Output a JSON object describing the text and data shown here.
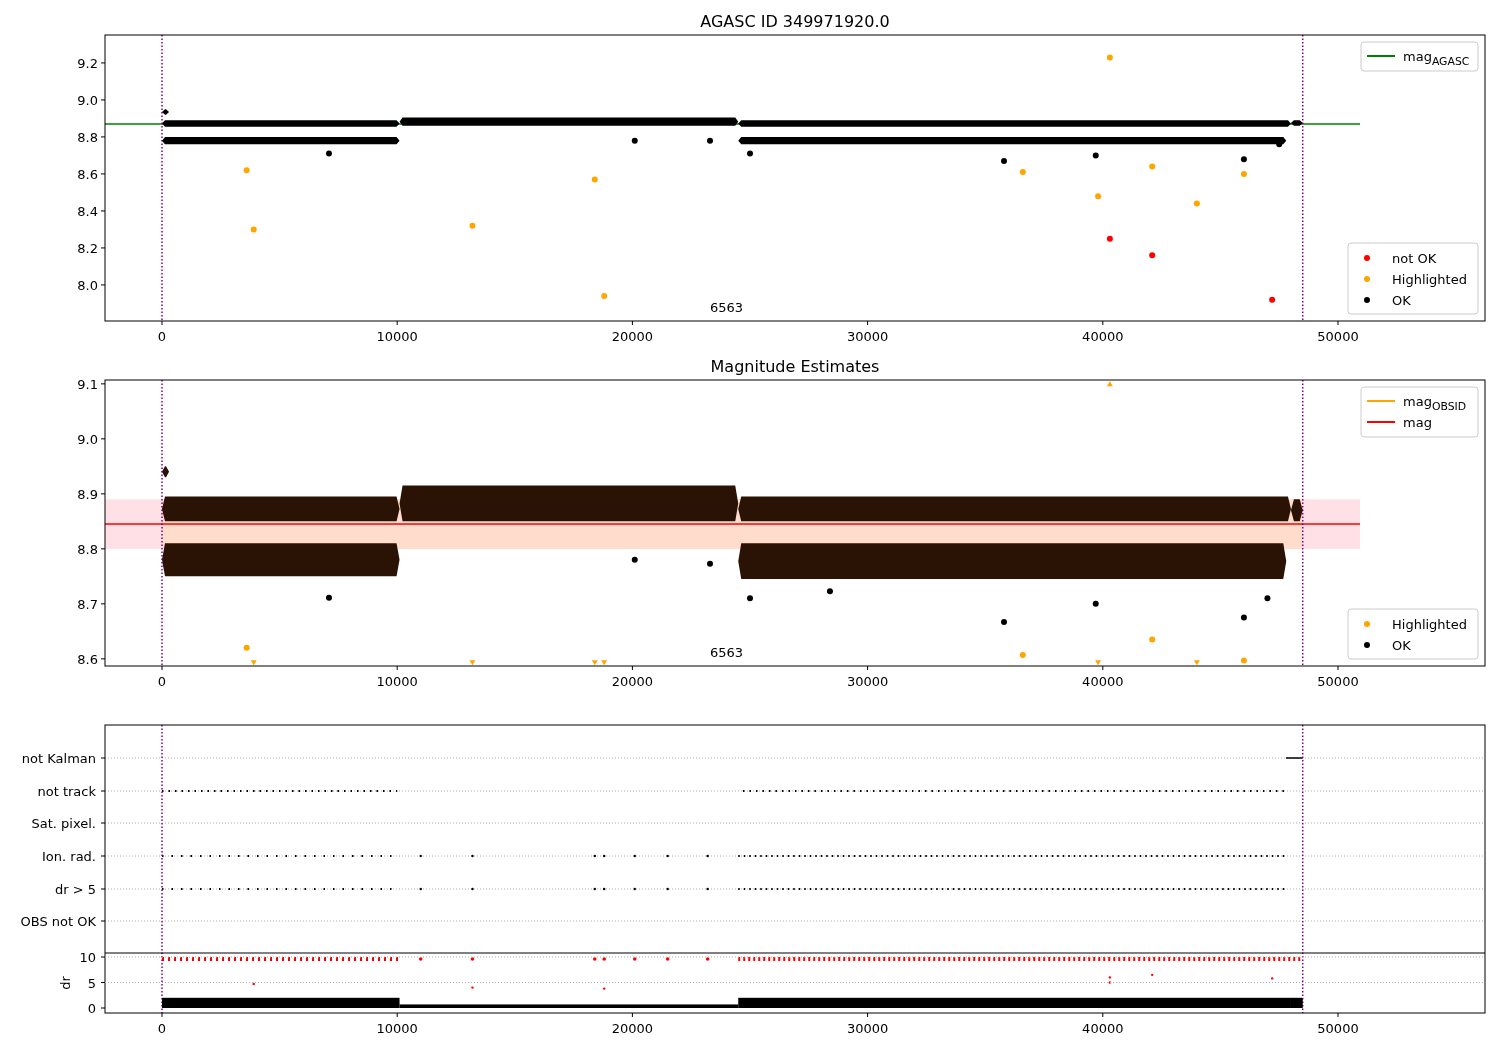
{
  "panels": [
    {
      "chart_data": {
        "type": "scatter",
        "title": "AGASC ID 349971920.0",
        "legend": "right",
        "xlim": [
          -2423,
          56250
        ],
        "ylim": [
          7.805,
          9.351
        ],
        "xticks": [
          0,
          10000,
          20000,
          30000,
          40000,
          50000
        ],
        "yticks": [
          {
            "value": 8.0,
            "label": "8.0"
          },
          {
            "value": 8.2,
            "label": "8.2"
          },
          {
            "value": 8.4,
            "label": "8.4"
          },
          {
            "value": 8.6,
            "label": "8.6"
          },
          {
            "value": 8.8,
            "label": "8.8"
          },
          {
            "value": 9.0,
            "label": "9.0"
          },
          {
            "value": 9.2,
            "label": "9.2"
          }
        ],
        "x": [
          3600,
          3900,
          7100,
          13200,
          18400,
          18800,
          20100,
          23300,
          25000,
          35800,
          36600,
          39700,
          39800,
          40300,
          42100,
          44000,
          46000,
          47200,
          47500
        ],
        "series": [
          {
            "name": "not OK",
            "color": "#ff0000",
            "values": [
              null,
              null,
              null,
              null,
              null,
              null,
              null,
              null,
              null,
              null,
              null,
              null,
              null,
              8.25,
              8.16,
              null,
              null,
              7.92,
              null
            ]
          },
          {
            "name": "Highlighted",
            "color": "#ffa500",
            "values": [
              8.62,
              8.3,
              null,
              8.32,
              8.57,
              7.94,
              null,
              null,
              null,
              null,
              8.61,
              null,
              8.48,
              9.23,
              8.64,
              8.44,
              8.6,
              null,
              null
            ]
          },
          {
            "name": "OK",
            "color": "#000000",
            "values": [
              null,
              null,
              8.71,
              null,
              null,
              null,
              8.78,
              8.78,
              8.71,
              8.67,
              null,
              8.7,
              null,
              null,
              null,
              null,
              8.68,
              null,
              8.76
            ]
          }
        ],
        "ref_lines": [
          {
            "axis": "y",
            "value": 8.87,
            "label": "mag$_{AGASC}$",
            "color": "#008000"
          },
          {
            "axis": "x",
            "value": 0,
            "color": "#800080"
          },
          {
            "axis": "x",
            "value": 48500,
            "color": "#800080"
          }
        ],
        "annotations": [
          {
            "text": "6563"
          }
        ]
      }
    },
    {
      "chart_data": {
        "type": "scatter",
        "title": "Magnitude Estimates",
        "legend": "right",
        "xlim": [
          -2423,
          56250
        ],
        "ylim": [
          8.587,
          9.107
        ],
        "xticks": [
          0,
          10000,
          20000,
          30000,
          40000,
          50000
        ],
        "yticks": [
          {
            "value": 8.6,
            "label": "8.6"
          },
          {
            "value": 8.7,
            "label": "8.7"
          },
          {
            "value": 8.8,
            "label": "8.8"
          },
          {
            "value": 8.9,
            "label": "8.9"
          },
          {
            "value": 9.0,
            "label": "9.0"
          },
          {
            "value": 9.1,
            "label": "9.1"
          }
        ],
        "x": [
          3600,
          3900,
          7100,
          13200,
          18400,
          18800,
          20100,
          23300,
          25000,
          28400,
          35800,
          36600,
          39700,
          39800,
          40300,
          42100,
          44000,
          46000,
          47000
        ],
        "series": [
          {
            "name": "Highlighted",
            "color": "#ffa500",
            "values": [
              8.62,
              8.593,
              null,
              8.593,
              8.593,
              8.593,
              null,
              null,
              null,
              null,
              null,
              8.607,
              null,
              8.593,
              9.1,
              8.635,
              8.593,
              8.597,
              null
            ]
          },
          {
            "name": "OK",
            "color": "#000000",
            "values": [
              null,
              null,
              8.711,
              null,
              null,
              null,
              8.78,
              8.773,
              8.71,
              8.723,
              8.667,
              null,
              8.7,
              null,
              null,
              null,
              null,
              8.675,
              8.71
            ]
          }
        ],
        "bands": [
          {
            "axis": "y",
            "from": 8.8,
            "to": 8.89,
            "color": "#ffe0e6"
          },
          {
            "axis": "y",
            "from": 8.8,
            "to": 8.89,
            "color": "#ffdccc"
          }
        ],
        "ref_lines": [
          {
            "axis": "y",
            "label": "mag$_{OBSID}$",
            "color": "#ffa500"
          },
          {
            "axis": "y",
            "value": 8.845,
            "label": "mag",
            "color": "#ff0000"
          },
          {
            "axis": "x",
            "value": 0,
            "color": "#800080"
          },
          {
            "axis": "x",
            "value": 48500,
            "color": "#800080"
          }
        ],
        "annotations": [
          {
            "text": "6563"
          }
        ]
      }
    }
  ],
  "flags": {
    "rows": [
      "not Kalman",
      "not track",
      "Sat. pixel.",
      "Ion. rad.",
      "dr > 5",
      "OBS not OK"
    ],
    "dr_label": "dr",
    "dr_yticks": [
      "10",
      "5",
      "0"
    ],
    "xticks": [
      "0",
      "10000",
      "20000",
      "30000",
      "40000",
      "50000"
    ]
  }
}
